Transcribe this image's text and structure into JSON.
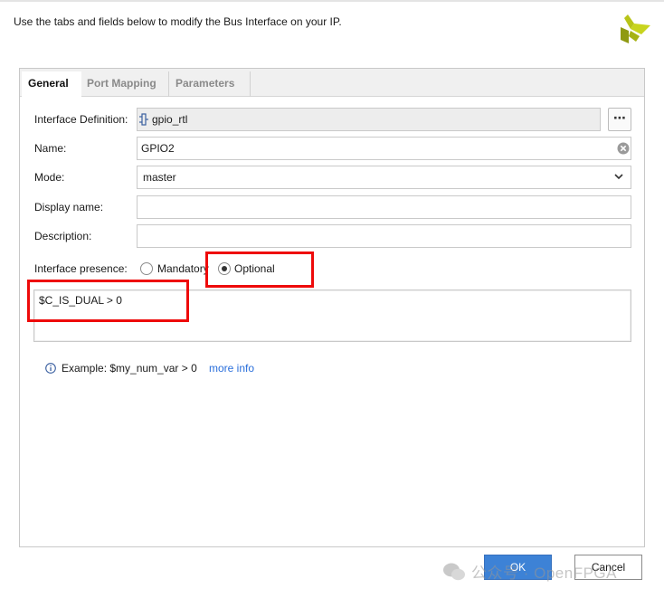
{
  "header": {
    "instruction": "Use the tabs and fields below to modify the Bus Interface on your IP.",
    "logo_icon": "vivado-logo-icon"
  },
  "tabs": [
    {
      "label": "General",
      "active": true
    },
    {
      "label": "Port Mapping",
      "active": false
    },
    {
      "label": "Parameters",
      "active": false
    }
  ],
  "form": {
    "interface_definition": {
      "label": "Interface Definition:",
      "value": "gpio_rtl",
      "icon": "port-icon",
      "button_label": "⋯"
    },
    "name": {
      "label": "Name:",
      "value": "GPIO2",
      "clear_icon": "clear-icon"
    },
    "mode": {
      "label": "Mode:",
      "value": "master",
      "dropdown_icon": "chevron-down-icon"
    },
    "display_name": {
      "label": "Display name:",
      "value": ""
    },
    "description": {
      "label": "Description:",
      "value": ""
    },
    "presence": {
      "label": "Interface presence:",
      "options": [
        {
          "label": "Mandatory",
          "selected": false
        },
        {
          "label": "Optional",
          "selected": true
        }
      ]
    },
    "expression": "$C_IS_DUAL > 0",
    "hint": {
      "text": "Example:  $my_num_var > 0",
      "link": "more info",
      "icon": "info-icon"
    }
  },
  "buttons": {
    "ok": "OK",
    "cancel": "Cancel"
  },
  "watermark": "公众号 · OpenFPGA",
  "colors": {
    "highlight": "#ee0a0a",
    "ok_button": "#3d82d6",
    "link": "#2a6fdb"
  }
}
